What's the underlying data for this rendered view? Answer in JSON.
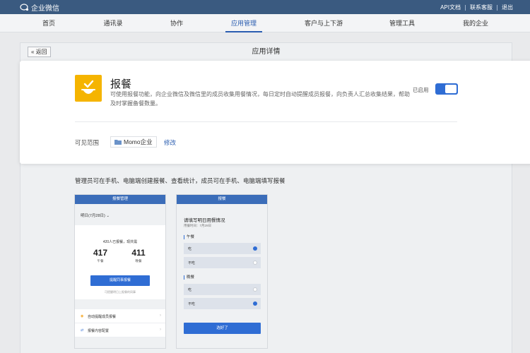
{
  "topbar": {
    "logo_text": "企业微信",
    "links": [
      "API文档",
      "联系客服",
      "退出"
    ]
  },
  "nav": {
    "tabs": [
      {
        "label": "首页",
        "active": false
      },
      {
        "label": "通讯录",
        "active": false
      },
      {
        "label": "协作",
        "active": false
      },
      {
        "label": "应用管理",
        "active": true
      },
      {
        "label": "客户与上下游",
        "active": false
      },
      {
        "label": "管理工具",
        "active": false
      },
      {
        "label": "我的企业",
        "active": false
      }
    ]
  },
  "panel": {
    "back_label": "« 返回",
    "title": "应用详情"
  },
  "app": {
    "name": "报餐",
    "description": "可使用报餐功能，向企业微信及微信里的成员收集用餐情况，每日定时自动提醒成员报餐，向负责人汇总收集结果，帮助及时掌握备餐数量。",
    "enabled_label": "已启用",
    "enabled": true,
    "icon": "meal-bowl-icon",
    "icon_color": "#f5b400",
    "scope_label": "可见范围",
    "scope_value": "Momo企业",
    "modify_label": "修改"
  },
  "feature_text": "管理员可在手机、电脑端创建报餐、查看统计，成员可在手机、电脑端填写报餐",
  "phone_admin": {
    "header": "报餐管理",
    "date": "明日(7月28日) ⌄",
    "summary": "420人已报餐，现共需",
    "stats": [
      {
        "value": "417",
        "label": "午餐"
      },
      {
        "value": "411",
        "label": "晚餐"
      }
    ],
    "button": "提醒同事报餐",
    "hint": "可提醒明日上报餐的同事",
    "items": [
      {
        "label": "自动提醒成员报餐",
        "icon": "bell-icon"
      },
      {
        "label": "报餐内容配置",
        "icon": "swap-icon"
      }
    ]
  },
  "phone_member": {
    "header": "报餐",
    "title": "请填写明日用餐情况",
    "subtitle": "用餐时间：7月29日",
    "sections": [
      {
        "label": "午餐",
        "options": [
          {
            "label": "吃",
            "selected": true
          },
          {
            "label": "不吃",
            "selected": false
          }
        ]
      },
      {
        "label": "晚餐",
        "options": [
          {
            "label": "吃",
            "selected": false
          },
          {
            "label": "不吃",
            "selected": true
          }
        ]
      }
    ],
    "button": "选好了"
  },
  "colors": {
    "topbar": "#3a5a80",
    "accent": "#2f6dd4",
    "phone_header": "#3b6db9"
  }
}
